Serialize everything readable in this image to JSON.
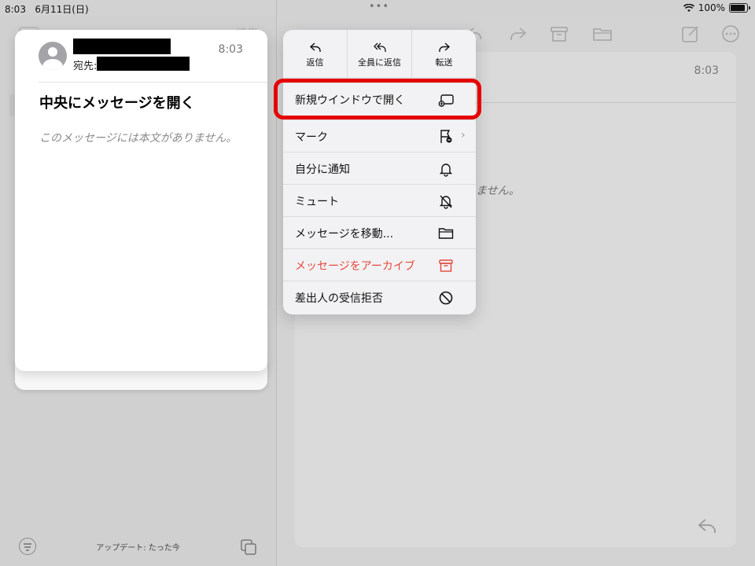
{
  "status_bar": {
    "time": "8:03",
    "date": "6月11日(日)",
    "battery": "100%"
  },
  "list_pane": {
    "edit_label": "編集",
    "update_text": "アップデート: たった今"
  },
  "preview": {
    "time": "8:03",
    "to_label": "宛先:",
    "subject": "中央にメッセージを開く",
    "body": "このメッセージには本文がありません。"
  },
  "detail": {
    "time": "8:03",
    "body_fragment": "ません。"
  },
  "menu": {
    "top_actions": [
      {
        "label": "返信",
        "icon": "reply-icon"
      },
      {
        "label": "全員に返信",
        "icon": "reply-all-icon"
      },
      {
        "label": "転送",
        "icon": "forward-icon"
      }
    ],
    "items": [
      {
        "label": "新規ウインドウで開く",
        "icon": "new-window-icon"
      },
      {
        "label": "マーク",
        "icon": "flag-icon"
      },
      {
        "label": "自分に通知",
        "icon": "bell-icon"
      },
      {
        "label": "ミュート",
        "icon": "bell-slash-icon"
      },
      {
        "label": "メッセージを移動...",
        "icon": "folder-icon"
      },
      {
        "label": "メッセージをアーカイブ",
        "icon": "archive-icon"
      },
      {
        "label": "差出人の受信拒否",
        "icon": "block-icon"
      }
    ]
  },
  "colors": {
    "highlight": "#e60000",
    "danger": "#e4483c"
  }
}
